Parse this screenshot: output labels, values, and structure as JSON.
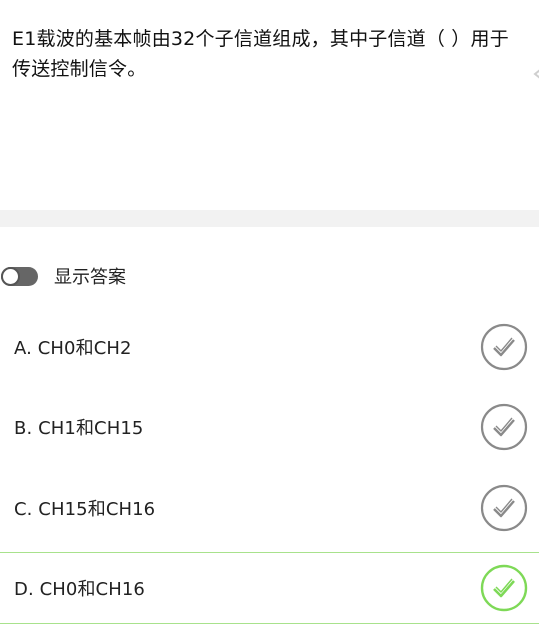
{
  "question": {
    "text": "E1载波的基本帧由32个子信道组成，其中子信道（ ）用于传送控制信令。"
  },
  "answer_toggle": {
    "label": "显示答案",
    "on": false
  },
  "options": [
    {
      "text": "A. CH0和CH2",
      "icon": "check-circle-icon",
      "state": "default"
    },
    {
      "text": "B. CH1和CH15",
      "icon": "check-circle-icon",
      "state": "default"
    },
    {
      "text": "C. CH15和CH16",
      "icon": "check-circle-icon",
      "state": "default"
    },
    {
      "text": "D. CH0和CH16",
      "icon": "check-circle-icon",
      "state": "correct"
    }
  ],
  "colors": {
    "default_check": "#8a8a8a",
    "correct_check": "#7ed957",
    "correct_border": "#a8e28c",
    "divider_band": "#f2f2f2"
  }
}
